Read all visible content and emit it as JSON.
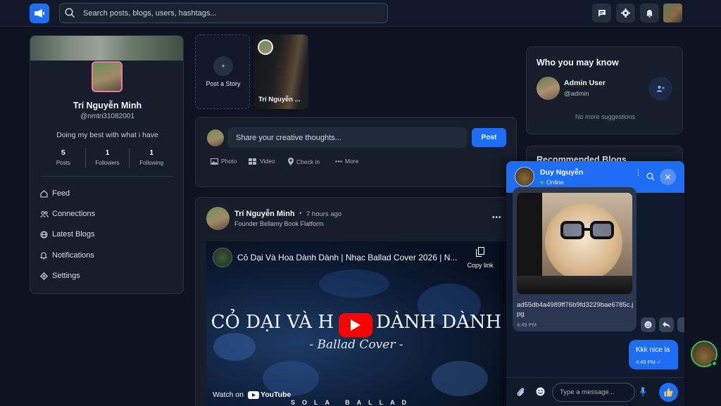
{
  "header": {
    "search_placeholder": "Search posts, blogs, users, hashtags...",
    "icons": [
      "logo-icon",
      "search-icon",
      "message-icon",
      "gear-icon",
      "bell-icon"
    ],
    "accent_color": "#1d6ef5"
  },
  "profile": {
    "name": "Trí Nguyễn Minh",
    "username": "@nmtri31082001",
    "bio": "Doing my best with what i have",
    "stats": [
      {
        "value": "5",
        "label": "Posts"
      },
      {
        "value": "1",
        "label": "Followers"
      },
      {
        "value": "1",
        "label": "Following"
      }
    ],
    "nav": [
      {
        "label": "Feed",
        "icon": "home-icon"
      },
      {
        "label": "Connections",
        "icon": "users-icon"
      },
      {
        "label": "Latest Blogs",
        "icon": "globe-icon"
      },
      {
        "label": "Notifications",
        "icon": "bell-icon"
      },
      {
        "label": "Settings",
        "icon": "gear-icon"
      }
    ]
  },
  "stories": {
    "add_label": "Post a Story",
    "add_symbol": "+",
    "items": [
      {
        "name": "Trí Nguyễn ..."
      }
    ]
  },
  "composer": {
    "placeholder": "Share your creative thoughts...",
    "post_label": "Post",
    "actions": [
      {
        "label": "Photo",
        "icon": "image-icon"
      },
      {
        "label": "Video",
        "icon": "video-icon"
      },
      {
        "label": "Check in",
        "icon": "location-icon"
      },
      {
        "label": "More",
        "icon": "dots-icon"
      }
    ]
  },
  "post": {
    "author": "Trí Nguyễn Minh",
    "separator": "•",
    "time": "7 hours ago",
    "subtitle": "Founder Bellamy Book Flatform",
    "more": "•••",
    "video": {
      "title": "Cỏ Dại Và Hoa Dành Dành | Nhạc Ballad Cover 2026 | N...",
      "copy_label": "Copy link",
      "overlay_line1": "CỎ DẠI VÀ H",
      "overlay_line1b": "DÀNH DÀNH",
      "overlay_line2": "- Ballad Cover -",
      "watch_label": "Watch on",
      "youtube_label": "YouTube",
      "bottom_text": "SOLA BALLAD"
    }
  },
  "suggestions": {
    "title": "Who you may know",
    "user_name": "Admin User",
    "user_handle": "@admin",
    "empty_text": "No more suggestions"
  },
  "recommended": {
    "title": "Recommended Blogs"
  },
  "chat": {
    "name": "Duy Nguyễn",
    "status": "Online",
    "kebab": "⋮",
    "close": "✕",
    "incoming": {
      "filename": "ad55db4a4989ff76b9fd3229bae6785c.jpg",
      "time": "4:49 PM"
    },
    "outgoing": {
      "text": "Kkk nice la",
      "time": "4:49 PM ✓"
    },
    "input_placeholder": "Type a message..."
  }
}
